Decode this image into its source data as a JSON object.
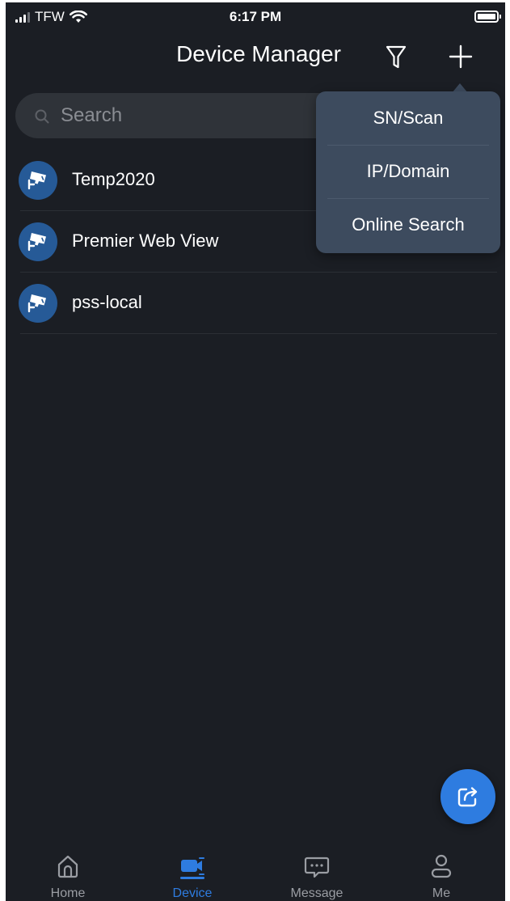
{
  "status_bar": {
    "carrier": "TFW",
    "time": "6:17 PM"
  },
  "header": {
    "title": "Device Manager"
  },
  "search": {
    "placeholder": "Search"
  },
  "devices": [
    {
      "name": "Temp2020"
    },
    {
      "name": "Premier Web View"
    },
    {
      "name": "pss-local"
    }
  ],
  "add_menu": {
    "items": [
      {
        "label": "SN/Scan"
      },
      {
        "label": "IP/Domain"
      },
      {
        "label": "Online Search"
      }
    ]
  },
  "tabs": [
    {
      "label": "Home",
      "icon": "home-icon",
      "active": false
    },
    {
      "label": "Device",
      "icon": "device-camera-icon",
      "active": true
    },
    {
      "label": "Message",
      "icon": "message-icon",
      "active": false
    },
    {
      "label": "Me",
      "icon": "person-icon",
      "active": false
    }
  ],
  "colors": {
    "background": "#1b1e24",
    "accent": "#2e7ce0",
    "menu_background": "#3d4b5e",
    "avatar": "#265a97",
    "search_background": "#2f3339"
  }
}
